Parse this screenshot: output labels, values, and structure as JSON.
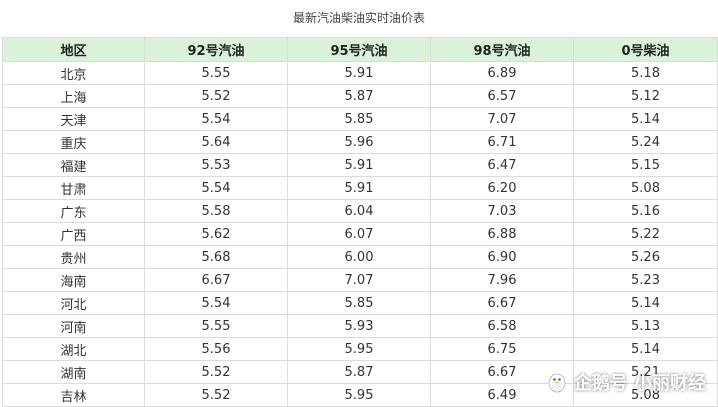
{
  "caption": "最新汽油柴油实时油价表",
  "headers": [
    "地区",
    "92号汽油",
    "95号汽油",
    "98号汽油",
    "0号柴油"
  ],
  "rows": [
    [
      "北京",
      "5.55",
      "5.91",
      "6.89",
      "5.18"
    ],
    [
      "上海",
      "5.52",
      "5.87",
      "6.57",
      "5.12"
    ],
    [
      "天津",
      "5.54",
      "5.85",
      "7.07",
      "5.14"
    ],
    [
      "重庆",
      "5.64",
      "5.96",
      "6.71",
      "5.24"
    ],
    [
      "福建",
      "5.53",
      "5.91",
      "6.47",
      "5.15"
    ],
    [
      "甘肃",
      "5.54",
      "5.91",
      "6.20",
      "5.08"
    ],
    [
      "广东",
      "5.58",
      "6.04",
      "7.03",
      "5.16"
    ],
    [
      "广西",
      "5.62",
      "6.07",
      "6.88",
      "5.22"
    ],
    [
      "贵州",
      "5.68",
      "6.00",
      "6.90",
      "5.26"
    ],
    [
      "海南",
      "6.67",
      "7.07",
      "7.96",
      "5.23"
    ],
    [
      "河北",
      "5.54",
      "5.85",
      "6.67",
      "5.14"
    ],
    [
      "河南",
      "5.55",
      "5.93",
      "6.58",
      "5.13"
    ],
    [
      "湖北",
      "5.56",
      "5.95",
      "6.75",
      "5.14"
    ],
    [
      "湖南",
      "5.52",
      "5.87",
      "6.67",
      "5.21"
    ],
    [
      "吉林",
      "5.52",
      "5.95",
      "6.49",
      "5.08"
    ]
  ],
  "watermark": {
    "text": "企鹅号 小丽财经",
    "icon": "penguin-icon"
  }
}
